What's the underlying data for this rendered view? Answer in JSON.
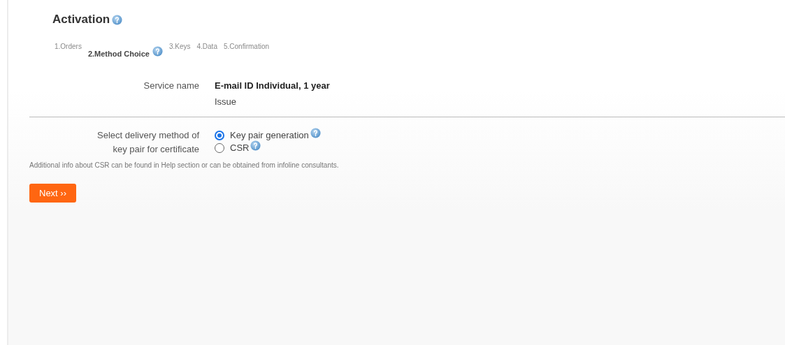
{
  "title": "Activation",
  "steps": [
    {
      "label": "1.Orders",
      "selected": false,
      "help": false
    },
    {
      "label": "2.Method Choice",
      "selected": true,
      "help": true
    },
    {
      "label": "3.Keys",
      "selected": false,
      "help": false
    },
    {
      "label": "4.Data",
      "selected": false,
      "help": false
    },
    {
      "label": "5.Confirmation",
      "selected": false,
      "help": false
    }
  ],
  "service": {
    "label": "Service name",
    "value": "E-mail ID Individual, 1 year",
    "note": "Issue"
  },
  "delivery": {
    "label_lines": [
      "Select delivery method of",
      "key pair for certificate"
    ],
    "options": [
      {
        "label": "Key pair generation",
        "selected": true
      },
      {
        "label": "CSR",
        "selected": false
      }
    ]
  },
  "info": "Additional info about CSR can be found in Help section or can be obtained from infoline consultants.",
  "next_button": "Next ››"
}
